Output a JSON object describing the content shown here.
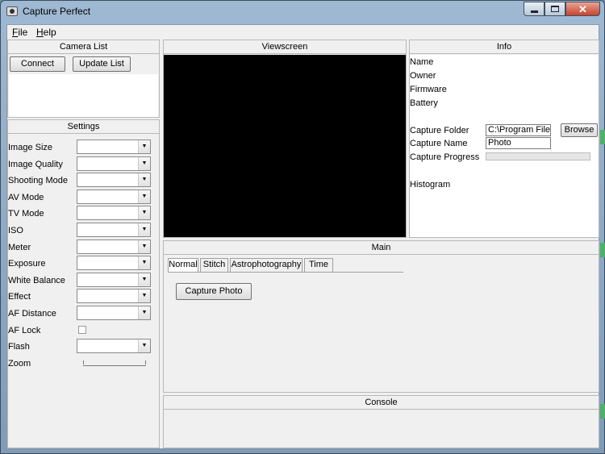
{
  "window": {
    "title": "Capture Perfect"
  },
  "menu": {
    "file": "File",
    "help": "Help"
  },
  "camera_list": {
    "header": "Camera List",
    "connect_label": "Connect",
    "update_label": "Update List"
  },
  "settings": {
    "header": "Settings",
    "fields": [
      "Image Size",
      "Image Quality",
      "Shooting Mode",
      "AV Mode",
      "TV Mode",
      "ISO",
      "Meter",
      "Exposure",
      "White Balance",
      "Effect",
      "AF Distance",
      "AF Lock",
      "Flash",
      "Zoom"
    ],
    "combo_arrow": "▼"
  },
  "viewscreen": {
    "header": "Viewscreen"
  },
  "info": {
    "header": "Info",
    "name": "Name",
    "owner": "Owner",
    "firmware": "Firmware",
    "battery": "Battery",
    "capture_folder_label": "Capture Folder",
    "capture_folder_value": "C:\\Program Files",
    "browse_label": "Browse",
    "capture_name_label": "Capture Name",
    "capture_name_value": "Photo",
    "capture_progress_label": "Capture Progress",
    "capture_progress": 0,
    "histogram": "Histogram"
  },
  "main": {
    "header": "Main",
    "tabs": [
      "Normal",
      "Stitch",
      "Astrophotography",
      "Time"
    ],
    "active_tab": "Normal",
    "capture_button": "Capture Photo"
  },
  "console": {
    "header": "Console"
  },
  "colors": {
    "title_bar": "#9fb9d3",
    "close_button": "#c7442b",
    "viewscreen": "#000000",
    "edge_accent": "#4fb06a"
  }
}
